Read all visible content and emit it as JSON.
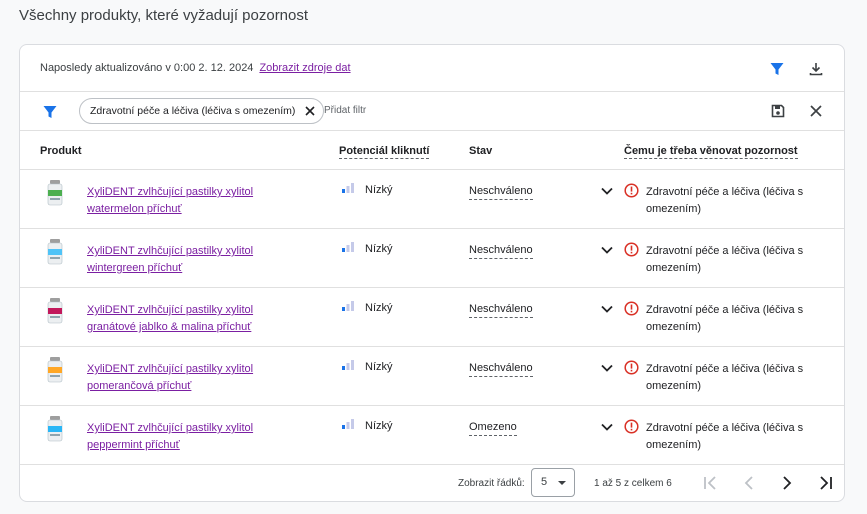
{
  "page": {
    "title": "Všechny produkty, které vyžadují pozornost"
  },
  "topbar": {
    "updated_text": "Naposledy aktualizováno v 0:00 2. 12. 2024",
    "source_link": "Zobrazit zdroje dat"
  },
  "filterbar": {
    "chip_label": "Zdravotní péče a léčiva (léčiva s omezením)",
    "add_filter": "Přidat filtr"
  },
  "table": {
    "headers": {
      "product": "Produkt",
      "potential": "Potenciál kliknutí",
      "status": "Stav",
      "attention": "Čemu je třeba věnovat pozornost"
    },
    "rows": [
      {
        "name": "XyliDENT zvlhčující pastilky xylitol watermelon příchuť",
        "potential": "Nízký",
        "status": "Neschváleno",
        "issue": "Zdravotní péče a léčiva (léčiva s omezením)",
        "thumb_color": "#4caf50"
      },
      {
        "name": "XyliDENT zvlhčující pastilky xylitol wintergreen příchuť",
        "potential": "Nízký",
        "status": "Neschváleno",
        "issue": "Zdravotní péče a léčiva (léčiva s omezením)",
        "thumb_color": "#4fc3f7"
      },
      {
        "name": "XyliDENT zvlhčující pastilky xylitol granátové jablko & malina příchuť",
        "potential": "Nízký",
        "status": "Neschváleno",
        "issue": "Zdravotní péče a léčiva (léčiva s omezením)",
        "thumb_color": "#c2185b"
      },
      {
        "name": "XyliDENT zvlhčující pastilky xylitol pomerančová příchuť",
        "potential": "Nízký",
        "status": "Neschváleno",
        "issue": "Zdravotní péče a léčiva (léčiva s omezením)",
        "thumb_color": "#ffa726"
      },
      {
        "name": "XyliDENT zvlhčující pastilky xylitol peppermint příchuť",
        "potential": "Nízký",
        "status": "Omezeno",
        "issue": "Zdravotní péče a léčiva (léčiva s omezením)",
        "thumb_color": "#29b6f6"
      }
    ]
  },
  "footer": {
    "rows_label": "Zobrazit řádků:",
    "rows_value": "5",
    "range_text": "1 až 5 z celkem 6"
  },
  "colors": {
    "accent": "#1a73e8",
    "link": "#7b1fa2",
    "warning": "#d93025"
  },
  "icons": [
    "filter-icon",
    "download-icon",
    "save-icon",
    "close-icon",
    "signal-low-icon",
    "chevron-down-icon",
    "error-icon",
    "first-page-icon",
    "prev-page-icon",
    "next-page-icon",
    "last-page-icon"
  ]
}
